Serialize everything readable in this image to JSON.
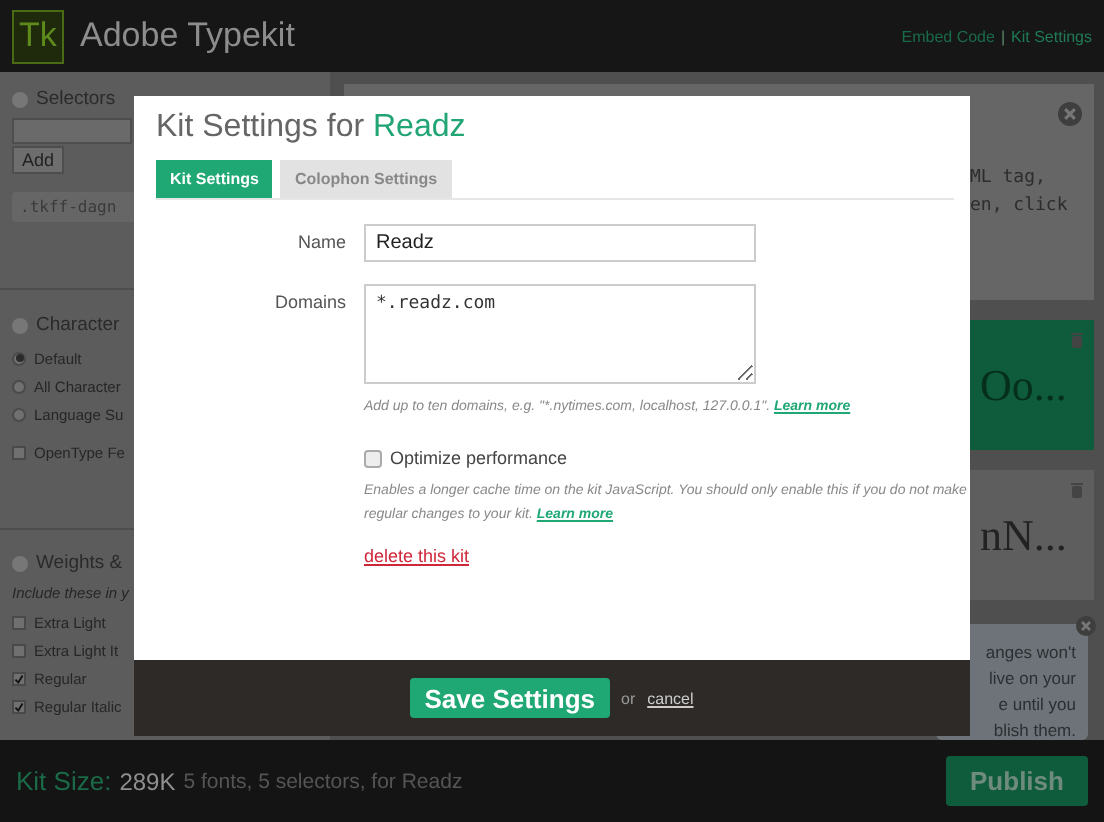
{
  "header": {
    "logo": "Tk",
    "title": "Adobe Typekit",
    "links": [
      {
        "label": "Embed Code",
        "selected": false
      },
      {
        "label": "Kit Settings",
        "selected": true
      }
    ],
    "separator": "|"
  },
  "sidebar": {
    "selectors": {
      "heading": "Selectors",
      "add_button": "Add",
      "code": ".tkff-dagn"
    },
    "character": {
      "heading": "Character",
      "options": [
        {
          "label": "Default",
          "selected": true
        },
        {
          "label": "All Character",
          "selected": false
        },
        {
          "label": "Language Su",
          "selected": false
        }
      ],
      "opentype": {
        "label": "OpenType Fe",
        "checked": false
      }
    },
    "weights": {
      "heading": "Weights &",
      "note": "Include these in y",
      "items": [
        {
          "label": "Extra Light",
          "checked": false
        },
        {
          "label": "Extra Light It",
          "checked": false
        },
        {
          "label": "Regular",
          "checked": true
        },
        {
          "label": "Regular Italic",
          "checked": true
        }
      ]
    }
  },
  "content": {
    "instructions": [
      "ML tag,",
      "en, click"
    ],
    "cards": [
      {
        "sample": "Oo...",
        "selected": true
      },
      {
        "sample": "nN...",
        "selected": false
      }
    ],
    "tooltip": [
      "anges won't",
      "live on your",
      "e until you",
      "blish them."
    ]
  },
  "modal": {
    "title": "Kit Settings for",
    "title_accent": "Readz",
    "tabs": [
      {
        "label": "Kit Settings",
        "selected": true
      },
      {
        "label": "Colophon Settings",
        "selected": false
      }
    ],
    "name": {
      "label": "Name",
      "value": "Readz"
    },
    "domains": {
      "label": "Domains",
      "value": "*.readz.com",
      "hint": "Add up to ten domains, e.g. \"*.nytimes.com, localhost, 127.0.0.1\".",
      "hint_link": "Learn more"
    },
    "optimize": {
      "label": "Optimize performance",
      "checked": false,
      "description": "Enables a longer cache time on the kit JavaScript. You should only enable this if you do not make regular changes to your kit.",
      "description_link": "Learn more"
    },
    "delete_link": "delete this kit",
    "save_button": "Save Settings",
    "or": "or",
    "cancel": "cancel"
  },
  "footer": {
    "label": "Kit Size:",
    "size": "289K",
    "details": "5 fonts, 5 selectors, for Readz",
    "publish": "Publish"
  }
}
